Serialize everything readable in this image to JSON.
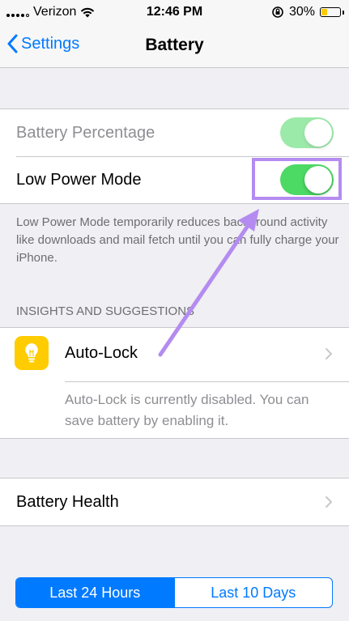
{
  "status_bar": {
    "carrier": "Verizon",
    "time": "12:46 PM",
    "battery_percent": "30%",
    "battery_level": 0.3,
    "icons": [
      "signal-icon",
      "wifi-icon",
      "rotation-lock-icon",
      "battery-icon"
    ]
  },
  "nav": {
    "back_label": "Settings",
    "title": "Battery"
  },
  "settings": {
    "battery_percentage": {
      "label": "Battery Percentage",
      "on": true
    },
    "low_power_mode": {
      "label": "Low Power Mode",
      "on": true
    }
  },
  "low_power_footnote": "Low Power Mode temporarily reduces background activity like downloads and mail fetch until you can fully charge your iPhone.",
  "insights": {
    "header": "INSIGHTS AND SUGGESTIONS",
    "item_label": "Auto-Lock",
    "item_icon": "lightbulb-icon",
    "item_description": "Auto-Lock is currently disabled. You can save battery by enabling it."
  },
  "battery_health": {
    "label": "Battery Health"
  },
  "time_range": {
    "options": [
      "Last 24 Hours",
      "Last 10 Days"
    ],
    "selected": "Last 24 Hours"
  },
  "colors": {
    "accent": "#007aff",
    "toggle_on": "#4cd964",
    "annotation": "#b48cf0",
    "battery_low": "#ffcc00"
  }
}
